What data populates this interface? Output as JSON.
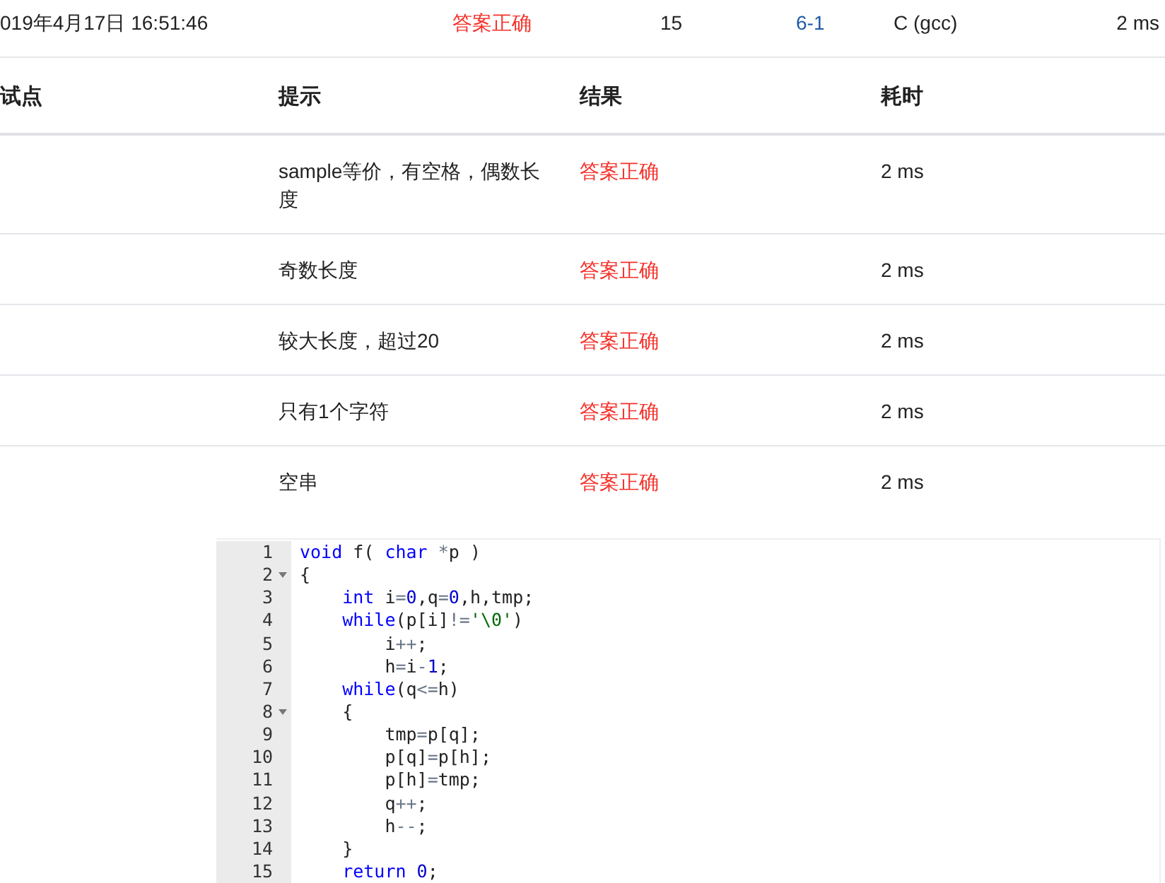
{
  "submission": {
    "time": "019年4月17日 16:51:46",
    "status": "答案正确",
    "score": "15",
    "problem": "6-1",
    "compiler": "C (gcc)",
    "duration": "2 ms"
  },
  "table": {
    "columns": [
      "试点",
      "提示",
      "结果",
      "耗时"
    ],
    "rows": [
      {
        "hint": "sample等价，有空格，偶数长度",
        "result": "答案正确",
        "time": "2 ms"
      },
      {
        "hint": "奇数长度",
        "result": "答案正确",
        "time": "2 ms"
      },
      {
        "hint": "较大长度，超过20",
        "result": "答案正确",
        "time": "2 ms"
      },
      {
        "hint": "只有1个字符",
        "result": "答案正确",
        "time": "2 ms"
      },
      {
        "hint": "空串",
        "result": "答案正确",
        "time": "2 ms"
      }
    ]
  },
  "code": {
    "lines": [
      {
        "number": "1",
        "foldable": false,
        "tokens": [
          {
            "kind": "keyword",
            "text": "void"
          },
          {
            "kind": "plain",
            "text": " f( "
          },
          {
            "kind": "keyword",
            "text": "char"
          },
          {
            "kind": "operator",
            "text": " *"
          },
          {
            "kind": "plain",
            "text": "p )"
          }
        ]
      },
      {
        "number": "2",
        "foldable": true,
        "tokens": [
          {
            "kind": "plain",
            "text": "{"
          }
        ]
      },
      {
        "number": "3",
        "foldable": false,
        "tokens": [
          {
            "kind": "keyword",
            "text": "    int"
          },
          {
            "kind": "plain",
            "text": " i"
          },
          {
            "kind": "operator",
            "text": "="
          },
          {
            "kind": "number",
            "text": "0"
          },
          {
            "kind": "plain",
            "text": ",q"
          },
          {
            "kind": "operator",
            "text": "="
          },
          {
            "kind": "number",
            "text": "0"
          },
          {
            "kind": "plain",
            "text": ",h,tmp;"
          }
        ]
      },
      {
        "number": "4",
        "foldable": false,
        "tokens": [
          {
            "kind": "keyword",
            "text": "    while"
          },
          {
            "kind": "plain",
            "text": "(p[i]"
          },
          {
            "kind": "operator",
            "text": "!="
          },
          {
            "kind": "string",
            "text": "'\\0'"
          },
          {
            "kind": "plain",
            "text": ")"
          }
        ]
      },
      {
        "number": "5",
        "foldable": false,
        "tokens": [
          {
            "kind": "plain",
            "text": "        i"
          },
          {
            "kind": "operator",
            "text": "++"
          },
          {
            "kind": "plain",
            "text": ";"
          }
        ]
      },
      {
        "number": "6",
        "foldable": false,
        "tokens": [
          {
            "kind": "plain",
            "text": "        h"
          },
          {
            "kind": "operator",
            "text": "="
          },
          {
            "kind": "plain",
            "text": "i"
          },
          {
            "kind": "operator",
            "text": "-"
          },
          {
            "kind": "number",
            "text": "1"
          },
          {
            "kind": "plain",
            "text": ";"
          }
        ]
      },
      {
        "number": "7",
        "foldable": false,
        "tokens": [
          {
            "kind": "keyword",
            "text": "    while"
          },
          {
            "kind": "plain",
            "text": "(q"
          },
          {
            "kind": "operator",
            "text": "<="
          },
          {
            "kind": "plain",
            "text": "h)"
          }
        ]
      },
      {
        "number": "8",
        "foldable": true,
        "tokens": [
          {
            "kind": "plain",
            "text": "    {"
          }
        ]
      },
      {
        "number": "9",
        "foldable": false,
        "tokens": [
          {
            "kind": "plain",
            "text": "        tmp"
          },
          {
            "kind": "operator",
            "text": "="
          },
          {
            "kind": "plain",
            "text": "p[q];"
          }
        ]
      },
      {
        "number": "10",
        "foldable": false,
        "tokens": [
          {
            "kind": "plain",
            "text": "        p[q]"
          },
          {
            "kind": "operator",
            "text": "="
          },
          {
            "kind": "plain",
            "text": "p[h];"
          }
        ]
      },
      {
        "number": "11",
        "foldable": false,
        "tokens": [
          {
            "kind": "plain",
            "text": "        p[h]"
          },
          {
            "kind": "operator",
            "text": "="
          },
          {
            "kind": "plain",
            "text": "tmp;"
          }
        ]
      },
      {
        "number": "12",
        "foldable": false,
        "tokens": [
          {
            "kind": "plain",
            "text": "        q"
          },
          {
            "kind": "operator",
            "text": "++"
          },
          {
            "kind": "plain",
            "text": ";"
          }
        ]
      },
      {
        "number": "13",
        "foldable": false,
        "tokens": [
          {
            "kind": "plain",
            "text": "        h"
          },
          {
            "kind": "operator",
            "text": "--"
          },
          {
            "kind": "plain",
            "text": ";"
          }
        ]
      },
      {
        "number": "14",
        "foldable": false,
        "tokens": [
          {
            "kind": "plain",
            "text": "    }"
          }
        ]
      },
      {
        "number": "15",
        "foldable": false,
        "tokens": [
          {
            "kind": "keyword",
            "text": "    return"
          },
          {
            "kind": "number",
            "text": " 0"
          },
          {
            "kind": "plain",
            "text": ";"
          }
        ]
      }
    ]
  }
}
